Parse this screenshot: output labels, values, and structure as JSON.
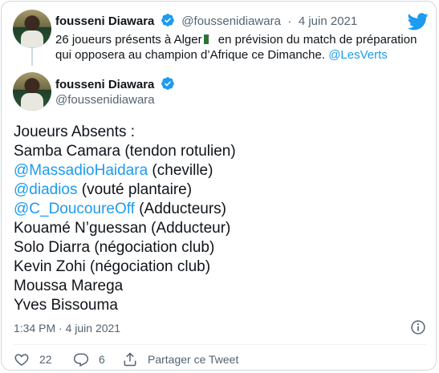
{
  "tweet": {
    "author_name": "fousseni Diawara",
    "author_handle": "@foussenidiawara",
    "body_lines": [
      "Joueurs Absents :",
      "Samba Camara (tendon rotulien)",
      "Kouamé N’guessan (Adducteur)",
      "Solo Diarra (négociation club)",
      "Kevin Zohi (négociation club)",
      "Moussa Marega",
      "Yves Bissouma"
    ],
    "mention_lines": [
      {
        "mention": "@MassadioHaidara",
        "text": " (cheville)"
      },
      {
        "mention": "@diadios",
        "text": " (vouté plantaire)"
      },
      {
        "mention": "@C_DoucoureOff",
        "text": " (Adducteurs)"
      }
    ],
    "timestamp": "1:34 PM · 4 juin 2021"
  },
  "reply_to": {
    "author_name": "fousseni Diawara",
    "author_handle": "@foussenidiawara",
    "separator": "·",
    "date": "4 juin 2021",
    "text_part1": "26 joueurs présents à Alger",
    "text_part2": " en prévision du match de préparation",
    "text_line2": "qui opposera au champion d’Afrique ce Dimanche. ",
    "hashtag_link": "@LesVerts"
  },
  "actions": {
    "like_count": "22",
    "reply_count": "6",
    "share_label": "Partager ce Tweet"
  },
  "colors": {
    "accent": "#1d9bf0",
    "text": "#0f1419",
    "muted": "#536471",
    "border": "#cfd9de"
  },
  "icons": [
    "twitter-bird-icon",
    "verified-badge-icon",
    "info-icon",
    "heart-icon",
    "reply-icon",
    "share-icon"
  ]
}
